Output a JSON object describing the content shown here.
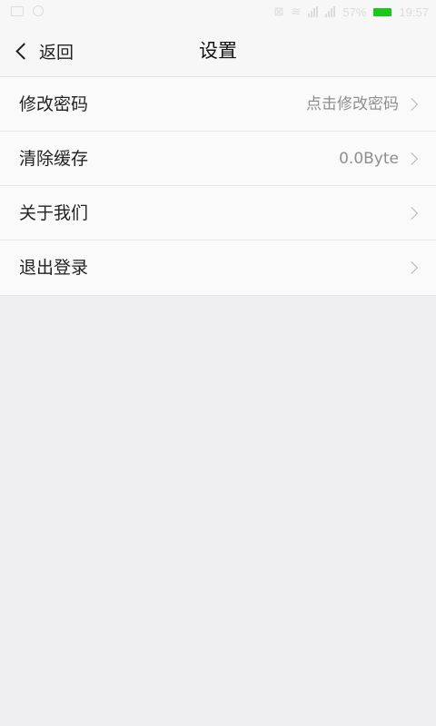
{
  "status_bar": {
    "signal_1": "ıl",
    "signal_2": "ıl",
    "battery_percent": "57%",
    "time": "19:57",
    "battery_color": "#19c919"
  },
  "nav": {
    "back_label": "返回",
    "title": "设置"
  },
  "settings": [
    {
      "label": "修改密码",
      "value": "点击修改密码",
      "icon": "chevron-right-icon"
    },
    {
      "label": "清除缓存",
      "value": "0.0Byte",
      "icon": "chevron-right-icon"
    },
    {
      "label": "关于我们",
      "value": "",
      "icon": "chevron-right-icon"
    },
    {
      "label": "退出登录",
      "value": "",
      "icon": "chevron-right-icon"
    }
  ]
}
